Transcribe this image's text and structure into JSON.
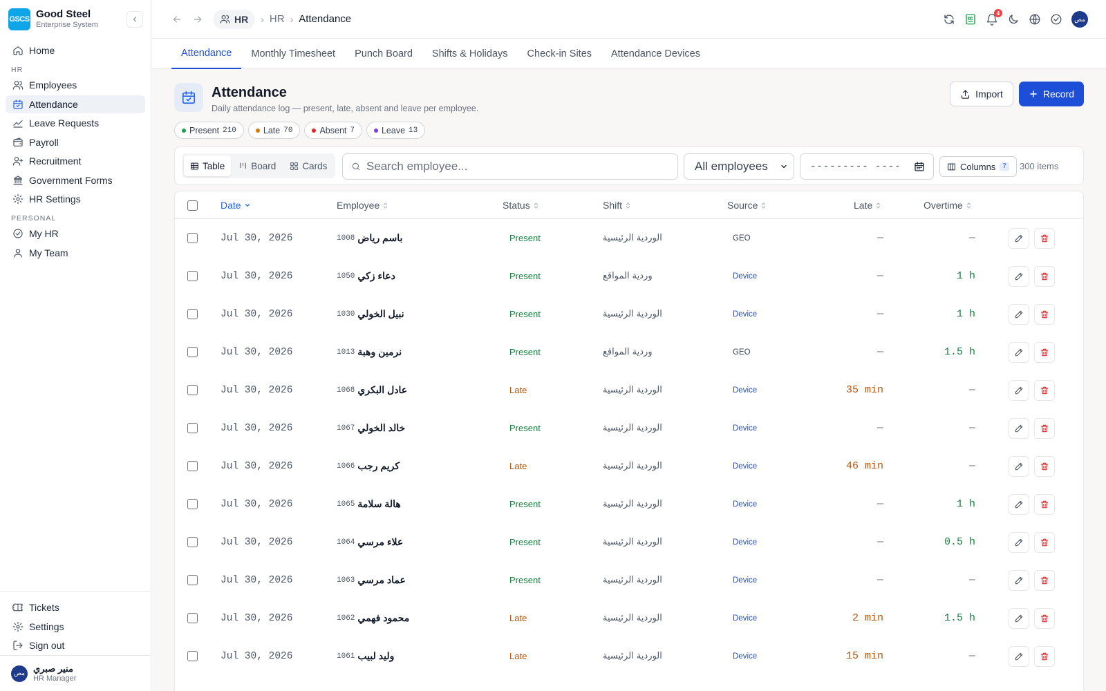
{
  "brand": {
    "logo": "GSCS",
    "name": "Good Steel",
    "subtitle": "Enterprise System"
  },
  "sidebar": {
    "home": "Home",
    "hr_section": "HR",
    "hr_items": [
      "Employees",
      "Attendance",
      "Leave Requests",
      "Payroll",
      "Recruitment",
      "Government Forms",
      "HR Settings"
    ],
    "personal_section": "PERSONAL",
    "personal_items": [
      "My HR",
      "My Team"
    ],
    "bottom_items": [
      "Tickets",
      "Settings",
      "Sign out"
    ],
    "active_item": "Attendance"
  },
  "user": {
    "initials": "مص",
    "name": "منير صبري",
    "role": "HR Manager"
  },
  "topbar": {
    "breadcrumb_module": "HR",
    "breadcrumb_section": "HR",
    "breadcrumb_current": "Attendance",
    "notification_count": "4",
    "avatar_initials": "مص"
  },
  "tabs": [
    "Attendance",
    "Monthly Timesheet",
    "Punch Board",
    "Shifts & Holidays",
    "Check-in Sites",
    "Attendance Devices"
  ],
  "active_tab": "Attendance",
  "page": {
    "title": "Attendance",
    "subtitle": "Daily attendance log — present, late, absent and leave per employee.",
    "import_label": "Import",
    "record_label": "Record"
  },
  "chips": [
    {
      "label": "Present",
      "count": "210",
      "color": "#16a34a"
    },
    {
      "label": "Late",
      "count": "70",
      "color": "#d97706"
    },
    {
      "label": "Absent",
      "count": "7",
      "color": "#dc2626"
    },
    {
      "label": "Leave",
      "count": "13",
      "color": "#7c3aed"
    }
  ],
  "toolbar": {
    "views": [
      "Table",
      "Board",
      "Cards"
    ],
    "active_view": "Table",
    "search_placeholder": "Search employee...",
    "filter_value": "All employees",
    "date_placeholder": "--------- ----",
    "columns_label": "Columns",
    "columns_count": "7",
    "items_count": "300 items"
  },
  "table": {
    "headers": [
      "Date",
      "Employee",
      "Status",
      "Shift",
      "Source",
      "Late",
      "Overtime"
    ],
    "rows": [
      {
        "date": "Jul 30, 2026",
        "emp_id": "1008",
        "name": "باسم رياض",
        "status": "Present",
        "shift": "الوردية الرئيسية",
        "source": "GEO",
        "late": "—",
        "overtime": "—"
      },
      {
        "date": "Jul 30, 2026",
        "emp_id": "1050",
        "name": "دعاء زكي",
        "status": "Present",
        "shift": "وردية المواقع",
        "source": "Device",
        "late": "—",
        "overtime": "1 h"
      },
      {
        "date": "Jul 30, 2026",
        "emp_id": "1030",
        "name": "نبيل الخولي",
        "status": "Present",
        "shift": "الوردية الرئيسية",
        "source": "Device",
        "late": "—",
        "overtime": "1 h"
      },
      {
        "date": "Jul 30, 2026",
        "emp_id": "1013",
        "name": "نرمين وهبة",
        "status": "Present",
        "shift": "وردية المواقع",
        "source": "GEO",
        "late": "—",
        "overtime": "1.5 h"
      },
      {
        "date": "Jul 30, 2026",
        "emp_id": "1068",
        "name": "عادل البكري",
        "status": "Late",
        "shift": "الوردية الرئيسية",
        "source": "Device",
        "late": "35 min",
        "overtime": "—"
      },
      {
        "date": "Jul 30, 2026",
        "emp_id": "1067",
        "name": "خالد الخولي",
        "status": "Present",
        "shift": "الوردية الرئيسية",
        "source": "Device",
        "late": "—",
        "overtime": "—"
      },
      {
        "date": "Jul 30, 2026",
        "emp_id": "1066",
        "name": "كريم رجب",
        "status": "Late",
        "shift": "الوردية الرئيسية",
        "source": "Device",
        "late": "46 min",
        "overtime": "—"
      },
      {
        "date": "Jul 30, 2026",
        "emp_id": "1065",
        "name": "هالة سلامة",
        "status": "Present",
        "shift": "الوردية الرئيسية",
        "source": "Device",
        "late": "—",
        "overtime": "1 h"
      },
      {
        "date": "Jul 30, 2026",
        "emp_id": "1064",
        "name": "علاء مرسي",
        "status": "Present",
        "shift": "الوردية الرئيسية",
        "source": "Device",
        "late": "—",
        "overtime": "0.5 h"
      },
      {
        "date": "Jul 30, 2026",
        "emp_id": "1063",
        "name": "عماد مرسي",
        "status": "Present",
        "shift": "الوردية الرئيسية",
        "source": "Device",
        "late": "—",
        "overtime": "—"
      },
      {
        "date": "Jul 30, 2026",
        "emp_id": "1062",
        "name": "محمود فهمي",
        "status": "Late",
        "shift": "الوردية الرئيسية",
        "source": "Device",
        "late": "2 min",
        "overtime": "1.5 h"
      },
      {
        "date": "Jul 30, 2026",
        "emp_id": "1061",
        "name": "وليد لبيب",
        "status": "Late",
        "shift": "الوردية الرئيسية",
        "source": "Device",
        "late": "15 min",
        "overtime": "—"
      }
    ]
  }
}
